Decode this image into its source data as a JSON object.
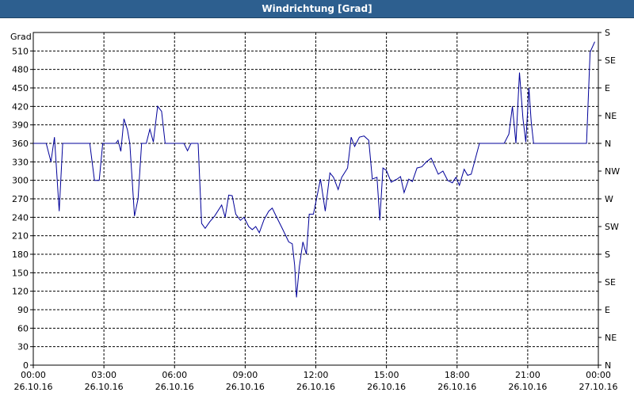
{
  "window": {
    "title": "Windrichtung [Grad]"
  },
  "colors": {
    "titlebar": "#2d5f8f",
    "series": "#000099",
    "grid": "#000000"
  },
  "chart_data": {
    "type": "line",
    "title": "Windrichtung [Grad]",
    "ylabel": "Grad",
    "xlabel": "",
    "ylim": [
      0,
      540
    ],
    "xlim": [
      0,
      24
    ],
    "grid": true,
    "y_ticks": [
      0,
      30,
      60,
      90,
      120,
      150,
      180,
      210,
      240,
      270,
      300,
      330,
      360,
      390,
      420,
      450,
      480,
      510
    ],
    "right_ticks": [
      {
        "value": 0,
        "label": "N"
      },
      {
        "value": 45,
        "label": "NE"
      },
      {
        "value": 90,
        "label": "E"
      },
      {
        "value": 135,
        "label": "SE"
      },
      {
        "value": 180,
        "label": "S"
      },
      {
        "value": 225,
        "label": "SW"
      },
      {
        "value": 270,
        "label": "W"
      },
      {
        "value": 315,
        "label": "NW"
      },
      {
        "value": 360,
        "label": "N"
      },
      {
        "value": 405,
        "label": "NE"
      },
      {
        "value": 450,
        "label": "E"
      },
      {
        "value": 495,
        "label": "SE"
      },
      {
        "value": 540,
        "label": "S"
      }
    ],
    "x_ticks": [
      {
        "value": 0,
        "time": "00:00",
        "date": "26.10.16"
      },
      {
        "value": 3,
        "time": "03:00",
        "date": "26.10.16"
      },
      {
        "value": 6,
        "time": "06:00",
        "date": "26.10.16"
      },
      {
        "value": 9,
        "time": "09:00",
        "date": "26.10.16"
      },
      {
        "value": 12,
        "time": "12:00",
        "date": "26.10.16"
      },
      {
        "value": 15,
        "time": "15:00",
        "date": "26.10.16"
      },
      {
        "value": 18,
        "time": "18:00",
        "date": "26.10.16"
      },
      {
        "value": 21,
        "time": "21:00",
        "date": "26.10.16"
      },
      {
        "value": 24,
        "time": "00:00",
        "date": "27.10.16"
      }
    ],
    "series": [
      {
        "points": [
          [
            0,
            360
          ],
          [
            0.55,
            360
          ],
          [
            0.75,
            330
          ],
          [
            0.9,
            370
          ],
          [
            1.1,
            250
          ],
          [
            1.25,
            360
          ],
          [
            2.4,
            360
          ],
          [
            2.6,
            300
          ],
          [
            2.8,
            300
          ],
          [
            2.95,
            360
          ],
          [
            3.5,
            360
          ],
          [
            3.6,
            365
          ],
          [
            3.72,
            347
          ],
          [
            3.85,
            400
          ],
          [
            4.0,
            382
          ],
          [
            4.1,
            360
          ],
          [
            4.3,
            242
          ],
          [
            4.45,
            270
          ],
          [
            4.6,
            360
          ],
          [
            4.8,
            360
          ],
          [
            4.95,
            383
          ],
          [
            5.1,
            362
          ],
          [
            5.28,
            420
          ],
          [
            5.45,
            412
          ],
          [
            5.6,
            360
          ],
          [
            6.4,
            360
          ],
          [
            6.55,
            348
          ],
          [
            6.7,
            360
          ],
          [
            7.0,
            360
          ],
          [
            7.15,
            230
          ],
          [
            7.3,
            222
          ],
          [
            7.5,
            233
          ],
          [
            7.7,
            242
          ],
          [
            8.0,
            260
          ],
          [
            8.15,
            240
          ],
          [
            8.3,
            276
          ],
          [
            8.45,
            275
          ],
          [
            8.6,
            245
          ],
          [
            8.8,
            235
          ],
          [
            8.95,
            240
          ],
          [
            9.15,
            225
          ],
          [
            9.3,
            220
          ],
          [
            9.45,
            225
          ],
          [
            9.6,
            215
          ],
          [
            9.8,
            236
          ],
          [
            10.0,
            250
          ],
          [
            10.15,
            255
          ],
          [
            10.3,
            243
          ],
          [
            10.6,
            220
          ],
          [
            10.85,
            200
          ],
          [
            11.0,
            197
          ],
          [
            11.1,
            162
          ],
          [
            11.18,
            110
          ],
          [
            11.3,
            160
          ],
          [
            11.45,
            200
          ],
          [
            11.6,
            180
          ],
          [
            11.72,
            245
          ],
          [
            11.9,
            245
          ],
          [
            12.2,
            302
          ],
          [
            12.4,
            250
          ],
          [
            12.6,
            312
          ],
          [
            12.75,
            305
          ],
          [
            12.95,
            285
          ],
          [
            13.1,
            305
          ],
          [
            13.35,
            320
          ],
          [
            13.5,
            370
          ],
          [
            13.65,
            355
          ],
          [
            13.85,
            370
          ],
          [
            14.05,
            372
          ],
          [
            14.25,
            365
          ],
          [
            14.4,
            302
          ],
          [
            14.6,
            305
          ],
          [
            14.72,
            235
          ],
          [
            14.85,
            320
          ],
          [
            15.0,
            316
          ],
          [
            15.2,
            297
          ],
          [
            15.45,
            302
          ],
          [
            15.6,
            306
          ],
          [
            15.75,
            280
          ],
          [
            15.95,
            302
          ],
          [
            16.1,
            298
          ],
          [
            16.3,
            320
          ],
          [
            16.5,
            322
          ],
          [
            16.7,
            330
          ],
          [
            16.9,
            336
          ],
          [
            17.2,
            310
          ],
          [
            17.4,
            315
          ],
          [
            17.6,
            300
          ],
          [
            17.8,
            296
          ],
          [
            17.95,
            305
          ],
          [
            18.1,
            292
          ],
          [
            18.3,
            318
          ],
          [
            18.45,
            308
          ],
          [
            18.6,
            310
          ],
          [
            18.95,
            360
          ],
          [
            20.0,
            360
          ],
          [
            20.2,
            375
          ],
          [
            20.35,
            420
          ],
          [
            20.5,
            360
          ],
          [
            20.65,
            475
          ],
          [
            20.8,
            400
          ],
          [
            20.92,
            362
          ],
          [
            21.05,
            450
          ],
          [
            21.15,
            395
          ],
          [
            21.25,
            360
          ],
          [
            23.5,
            360
          ],
          [
            23.65,
            508
          ],
          [
            23.85,
            525
          ]
        ]
      }
    ]
  }
}
